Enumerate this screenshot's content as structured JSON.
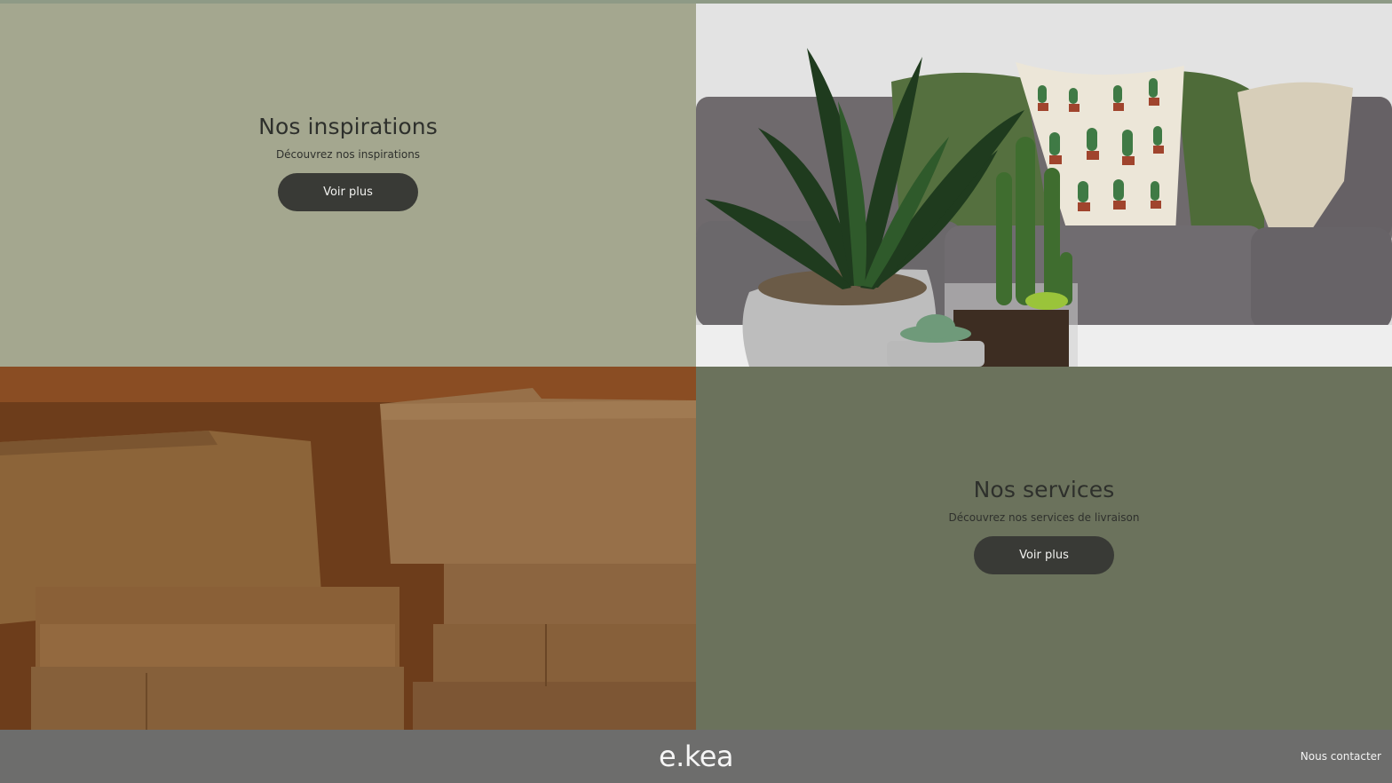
{
  "inspirations": {
    "title": "Nos inspirations",
    "subtitle": "Découvrez nos inspirations",
    "button_label": "Voir plus"
  },
  "services": {
    "title": "Nos services",
    "subtitle": "Découvrez nos services de livraison",
    "button_label": "Voir plus"
  },
  "images": {
    "top_right": "plants-and-sofa-photo",
    "bottom_left": "cardboard-boxes-photo"
  },
  "footer": {
    "logo": "e.kea",
    "contact_link": "Nous contacter"
  },
  "colors": {
    "inspirations_bg": "#a4a78f",
    "services_bg": "#6b725c",
    "button_bg": "#393a36",
    "footer_bg": "#6d6d6c"
  }
}
